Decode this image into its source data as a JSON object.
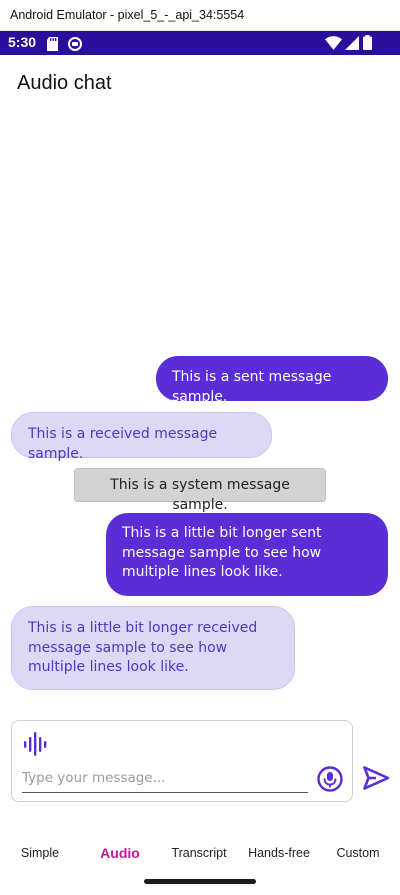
{
  "emulator": {
    "title": "Android Emulator - pixel_5_-_api_34:5554"
  },
  "status_bar": {
    "time": "5:30",
    "bg": "#2a0e9c"
  },
  "app": {
    "title": "Audio chat"
  },
  "messages": [
    {
      "type": "sent",
      "text": "This is a sent message sample."
    },
    {
      "type": "received",
      "text": "This is a received message sample."
    },
    {
      "type": "system",
      "text": "This is a system message sample."
    },
    {
      "type": "sent",
      "text": "This is a little bit longer sent message sample to see how multiple lines look like."
    },
    {
      "type": "received",
      "text": "This is a little bit longer received message sample to see how multiple lines look like."
    }
  ],
  "composer": {
    "placeholder": "Type your message...",
    "audio_icon": "audio-waveform-icon",
    "mic_icon": "microphone-icon",
    "send_icon": "send-icon"
  },
  "tabs": [
    {
      "label": "Simple",
      "active": false
    },
    {
      "label": "Audio",
      "active": true
    },
    {
      "label": "Transcript",
      "active": false
    },
    {
      "label": "Hands-free",
      "active": false
    },
    {
      "label": "Custom",
      "active": false
    }
  ],
  "colors": {
    "sent_bubble": "#5b2dd6",
    "received_bubble": "#ddd8f6",
    "received_text": "#4a3ac2",
    "system_bubble": "#d3d3d3",
    "accent": "#5b2dd6",
    "active_tab": "#c0189a"
  }
}
